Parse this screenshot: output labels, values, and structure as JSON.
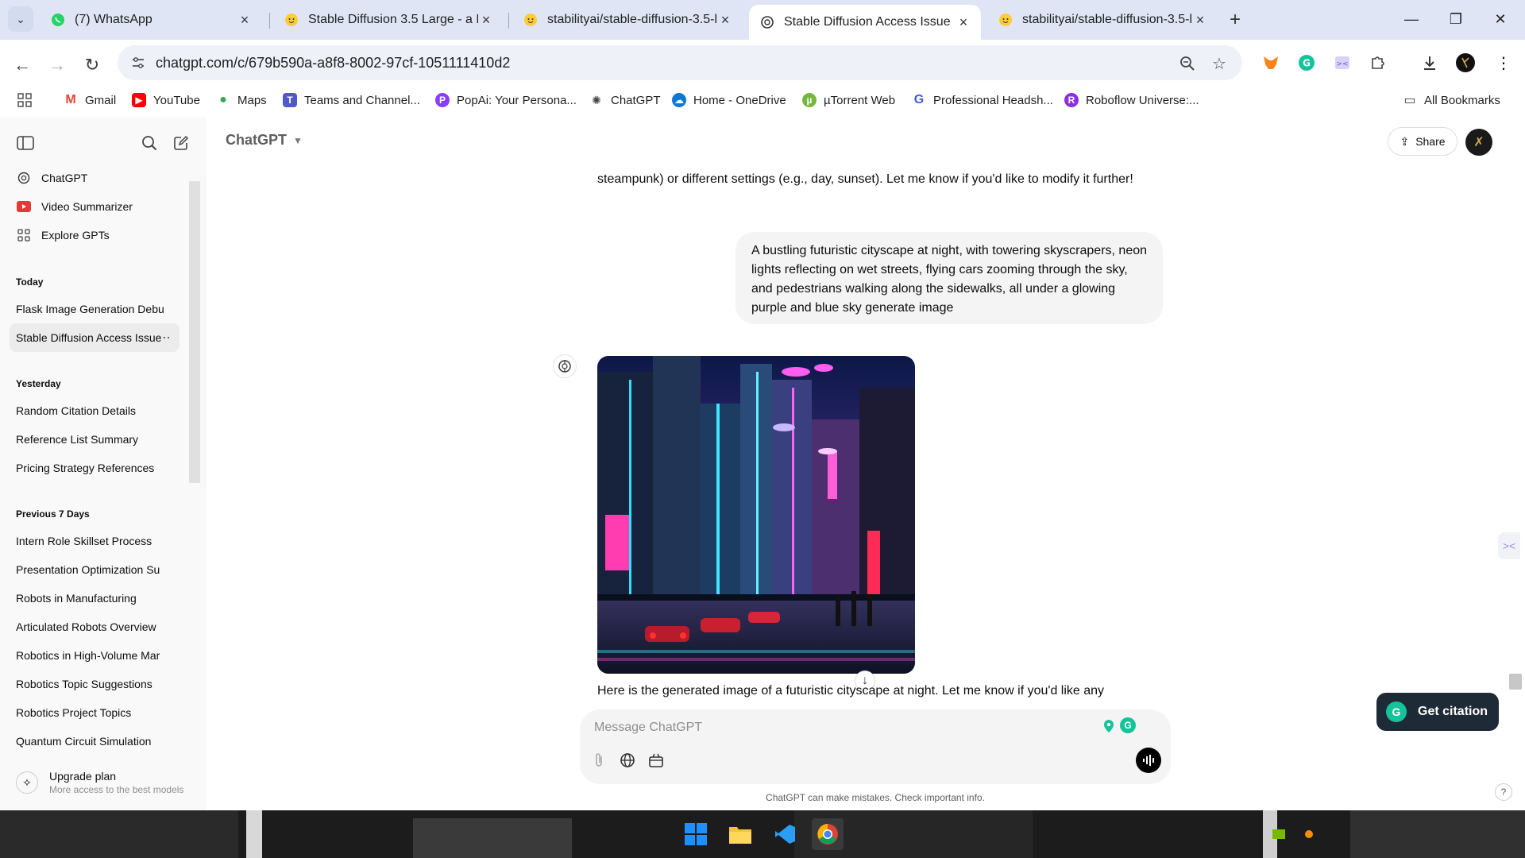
{
  "browser": {
    "tabs": [
      {
        "title": "(7) WhatsApp",
        "icon": "whatsapp-icon"
      },
      {
        "title": "Stable Diffusion 3.5 Large - a H",
        "icon": "huggingface-icon"
      },
      {
        "title": "stabilityai/stable-diffusion-3.5-l",
        "icon": "huggingface-icon"
      },
      {
        "title": "Stable Diffusion Access Issue",
        "icon": "openai-icon"
      },
      {
        "title": "stabilityai/stable-diffusion-3.5-l",
        "icon": "huggingface-icon"
      }
    ],
    "url": "chatgpt.com/c/679b590a-a8f8-8002-97cf-1051111410d2",
    "bookmarks": [
      {
        "label": "Gmail",
        "color": "#ea4335"
      },
      {
        "label": "YouTube",
        "color": "#ff0000"
      },
      {
        "label": "Maps",
        "color": "#34a853"
      },
      {
        "label": "Teams and Channel...",
        "color": "#5059c9"
      },
      {
        "label": "PopAi: Your Persona...",
        "color": "#8b3dff"
      },
      {
        "label": "ChatGPT",
        "color": "#444444"
      },
      {
        "label": "Home - OneDrive",
        "color": "#0f78d4"
      },
      {
        "label": "µTorrent Web",
        "color": "#76b83f"
      },
      {
        "label": "Professional Headsh...",
        "color": "#3b5bdb"
      },
      {
        "label": "Roboflow Universe:...",
        "color": "#8d2ee0"
      }
    ],
    "all_bookmarks": "All Bookmarks"
  },
  "sidebar": {
    "nav": [
      {
        "label": "ChatGPT",
        "icon": "openai-icon"
      },
      {
        "label": "Video Summarizer",
        "icon": "youtube-icon"
      },
      {
        "label": "Explore GPTs",
        "icon": "grid-icon"
      }
    ],
    "groups": [
      {
        "title": "Today",
        "items": [
          "Flask Image Generation Debu",
          "Stable Diffusion Access Issue"
        ]
      },
      {
        "title": "Yesterday",
        "items": [
          "Random Citation Details",
          "Reference List Summary",
          "Pricing Strategy References"
        ]
      },
      {
        "title": "Previous 7 Days",
        "items": [
          "Intern Role Skillset Process",
          "Presentation Optimization Su",
          "Robots in Manufacturing",
          "Articulated Robots Overview",
          "Robotics in High-Volume Mar",
          "Robotics Topic Suggestions",
          "Robotics Project Topics",
          "Quantum Circuit Simulation"
        ]
      }
    ],
    "upgrade": {
      "title": "Upgrade plan",
      "subtitle": "More access to the best models"
    }
  },
  "header": {
    "model": "ChatGPT",
    "share": "Share"
  },
  "conversation": {
    "assistant_top_text": "steampunk) or different settings (e.g., day, sunset). Let me know if you'd like to modify it further!",
    "user_message": "A bustling futuristic cityscape at night, with towering skyscrapers, neon lights reflecting on wet streets, flying cars zooming through the sky, and pedestrians walking along the sidewalks, all under a glowing purple and blue sky  generate image",
    "assistant_reply": "Here is the generated image of a futuristic cityscape at night. Let me know if you'd like any"
  },
  "composer": {
    "placeholder": "Message ChatGPT",
    "disclaimer": "ChatGPT can make mistakes. Check important info."
  },
  "extensions": {
    "citation_button": "Get citation"
  },
  "colors": {
    "accent": "#000000",
    "grammarly": "#15c39a",
    "sidebar_bg": "#f9f9f9",
    "bubble_bg": "#f4f4f4"
  }
}
